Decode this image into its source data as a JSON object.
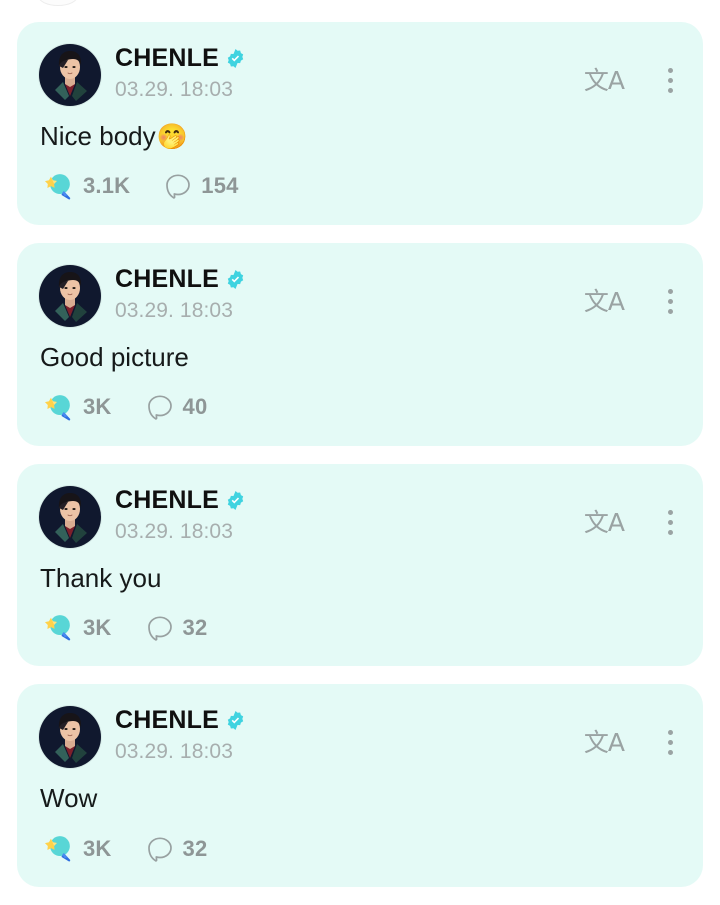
{
  "page": {
    "background_color": "#ffffff",
    "card_color": "#e4faf6",
    "accent_color": "#3fd3e0",
    "muted_text_color": "#a7aeae",
    "top_peek_label": "cut-off-avatar"
  },
  "icons": {
    "translate": "文A",
    "translate_name": "translate-icon",
    "menu_name": "more-options-icon",
    "reaction_name": "star-balloon-icon",
    "comment_name": "comment-bubble-icon",
    "verified_name": "verified-badge-icon"
  },
  "posts": [
    {
      "author": "CHENLE",
      "verified": true,
      "timestamp": "03.29. 18:03",
      "message": "Nice body",
      "emoji": "🤭",
      "reactions": "3.1K",
      "comments": "154",
      "translate_label": "文A"
    },
    {
      "author": "CHENLE",
      "verified": true,
      "timestamp": "03.29. 18:03",
      "message": "Good picture",
      "emoji": "",
      "reactions": "3K",
      "comments": "40",
      "translate_label": "文A"
    },
    {
      "author": "CHENLE",
      "verified": true,
      "timestamp": "03.29. 18:03",
      "message": "Thank you",
      "emoji": "",
      "reactions": "3K",
      "comments": "32",
      "translate_label": "文A"
    },
    {
      "author": "CHENLE",
      "verified": true,
      "timestamp": "03.29. 18:03",
      "message": "Wow",
      "emoji": "",
      "reactions": "3K",
      "comments": "32",
      "translate_label": "文A"
    }
  ]
}
